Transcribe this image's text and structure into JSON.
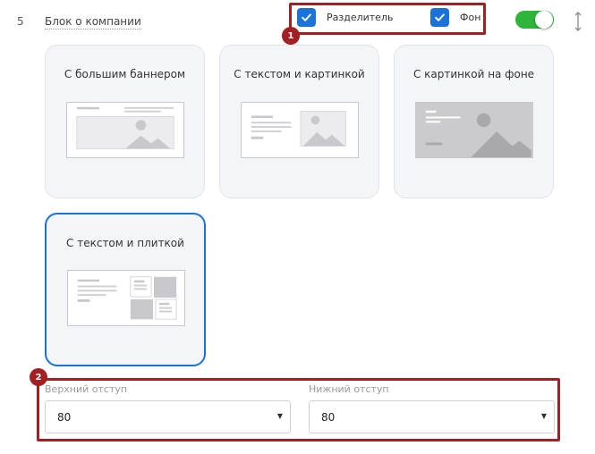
{
  "row": {
    "number": "5",
    "title": "Блок о компании"
  },
  "markers": [
    "1",
    "2"
  ],
  "options": {
    "divider_label": "Разделитель",
    "divider_checked": true,
    "background_label": "Фон",
    "background_checked": true,
    "enabled": true
  },
  "layouts": [
    {
      "label": "С большим баннером",
      "selected": false
    },
    {
      "label": "С текстом и картинкой",
      "selected": false
    },
    {
      "label": "С картинкой на фоне",
      "selected": false
    },
    {
      "label": "С текстом и плиткой",
      "selected": true
    }
  ],
  "paddings": {
    "top_label": "Верхний отступ",
    "top_value": "80",
    "bottom_label": "Нижний отступ",
    "bottom_value": "80"
  },
  "icons": {
    "checkbox": "checkmark-icon",
    "move": "vertical-arrows-icon",
    "dropdown": "caret-down-icon",
    "thumbnail": "image-placeholder-icon"
  },
  "colors": {
    "accent": "#1a73d9",
    "toggle_on": "#2fb53a",
    "highlight": "#a31f22",
    "card_bg": "#f4f5f8"
  }
}
